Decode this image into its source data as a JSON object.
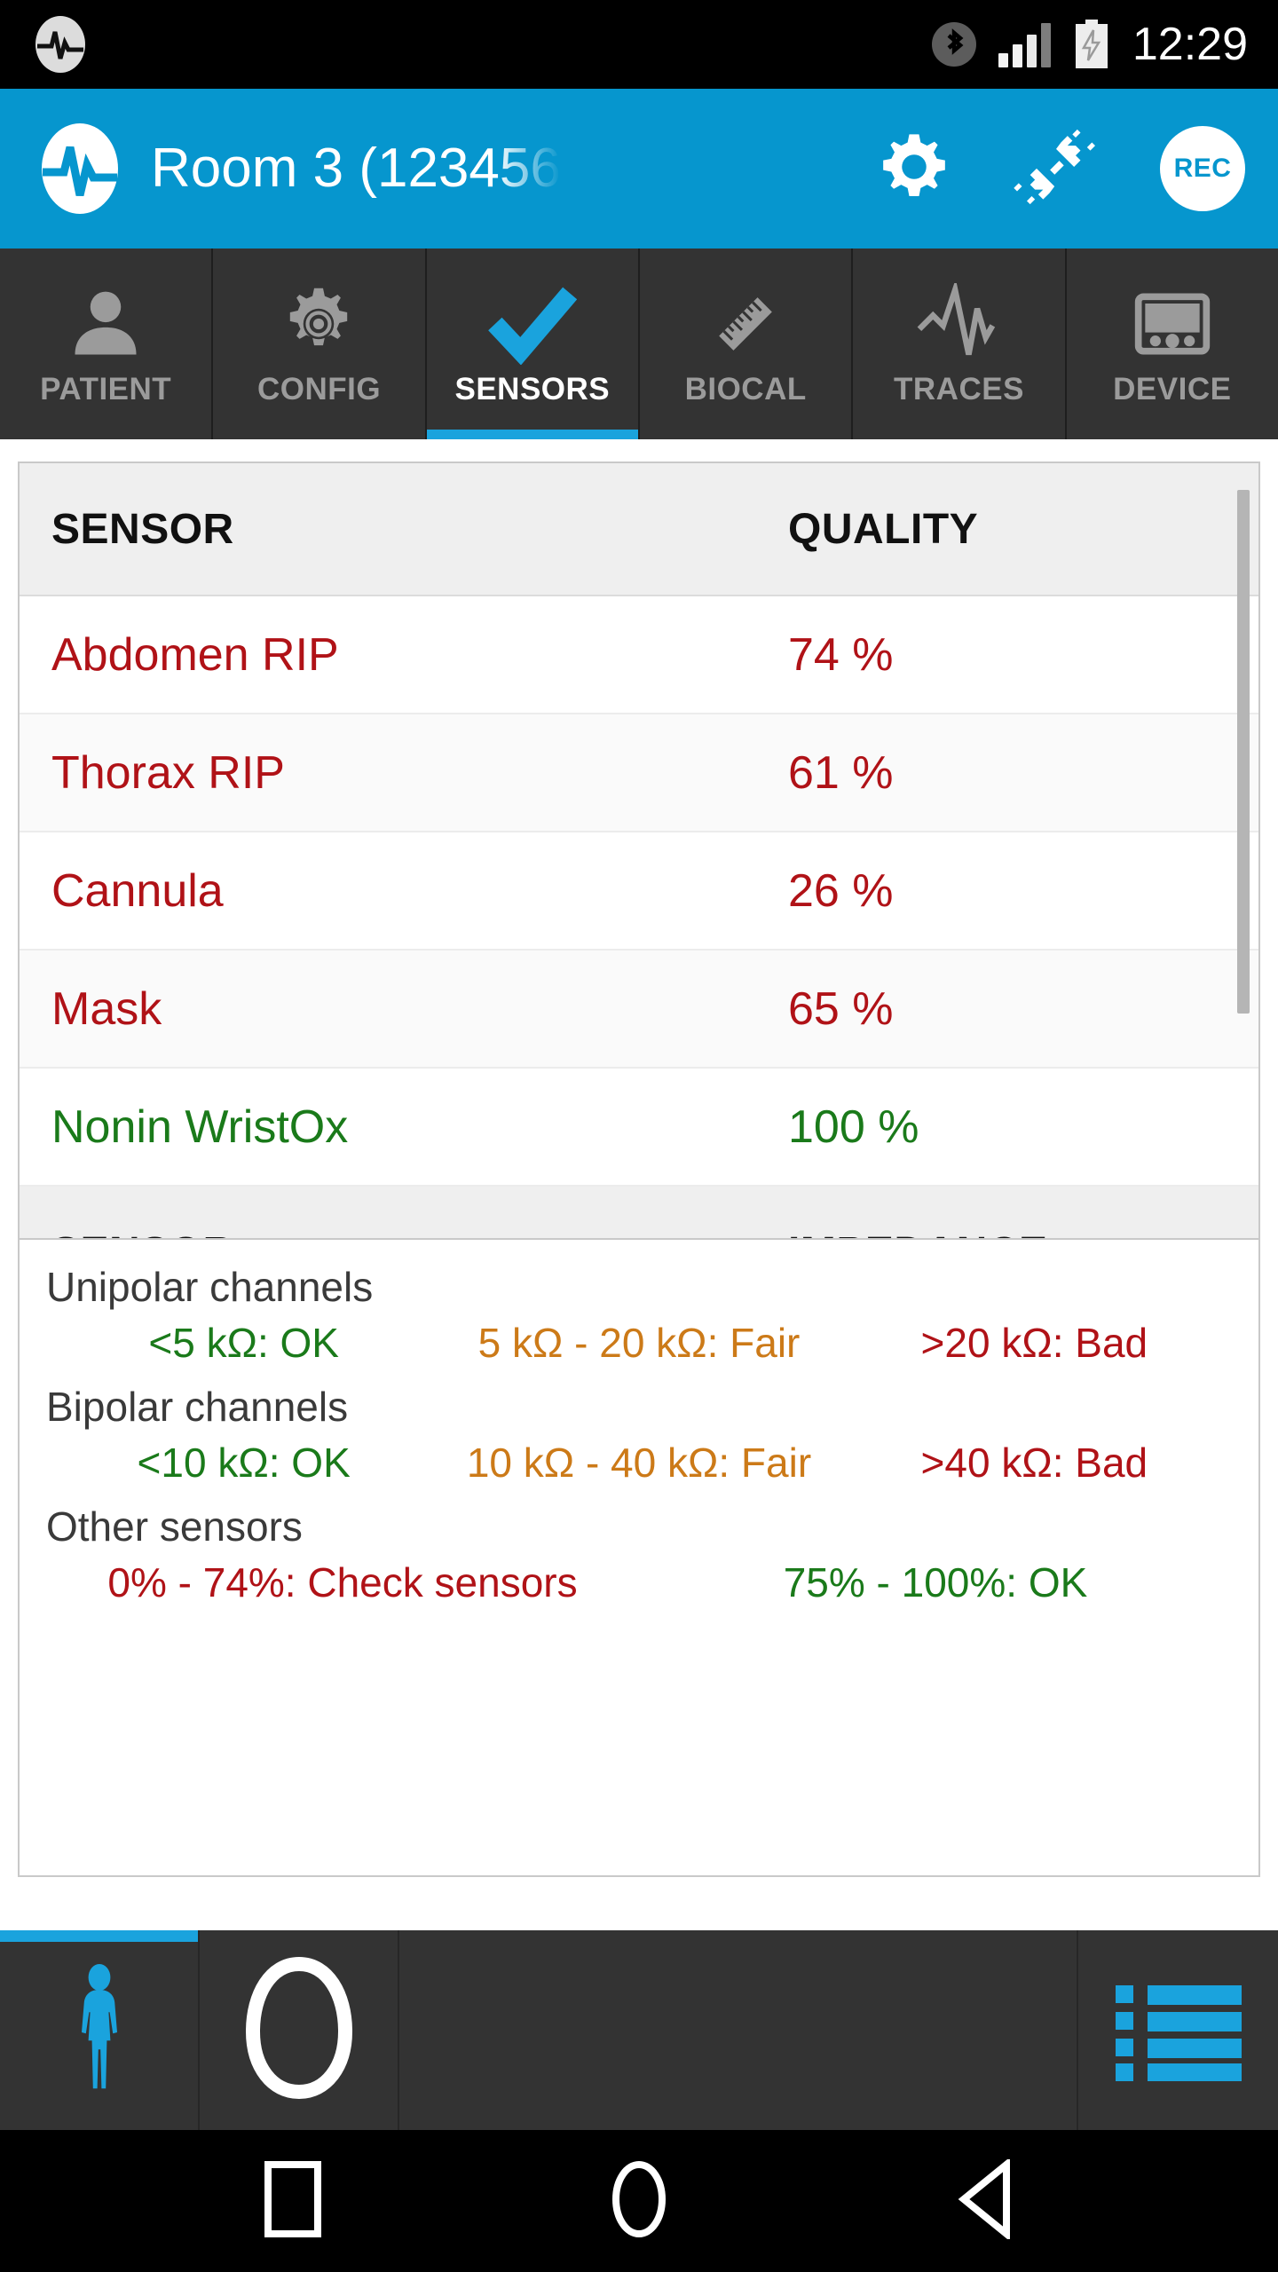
{
  "status_bar": {
    "app_icon": "waveform-logo-icon",
    "bluetooth_icon": "bluetooth-icon",
    "signal_icon": "cellular-signal-icon",
    "battery_icon": "battery-charging-icon",
    "time": "12:29"
  },
  "app_bar": {
    "logo_icon": "waveform-logo-icon",
    "title": "Room 3 (123456",
    "settings_icon": "gear-icon",
    "disconnect_icon": "unplugged-icon",
    "record_label": "REC"
  },
  "tabs": [
    {
      "label": "PATIENT",
      "icon": "person-icon",
      "active": false
    },
    {
      "label": "CONFIG",
      "icon": "gear-icon",
      "active": false
    },
    {
      "label": "SENSORS",
      "icon": "check-icon",
      "active": true
    },
    {
      "label": "BIOCAL",
      "icon": "ruler-icon",
      "active": false
    },
    {
      "label": "TRACES",
      "icon": "waveform-icon",
      "active": false
    },
    {
      "label": "DEVICE",
      "icon": "device-icon",
      "active": false
    }
  ],
  "sensor_table": {
    "headers": {
      "sensor": "SENSOR",
      "quality": "QUALITY"
    },
    "rows": [
      {
        "sensor": "Abdomen RIP",
        "quality": "74 %",
        "status": "bad"
      },
      {
        "sensor": "Thorax RIP",
        "quality": "61 %",
        "status": "bad"
      },
      {
        "sensor": "Cannula",
        "quality": "26 %",
        "status": "bad"
      },
      {
        "sensor": "Mask",
        "quality": "65 %",
        "status": "bad"
      },
      {
        "sensor": "Nonin WristOx",
        "quality": "100 %",
        "status": "good"
      }
    ],
    "next_headers": {
      "sensor": "SENSOR",
      "impedance": "IMPEDANCE"
    }
  },
  "legend": {
    "unipolar": {
      "title": "Unipolar channels",
      "ok": "<5 kΩ: OK",
      "fair": "5 kΩ - 20 kΩ: Fair",
      "bad": ">20 kΩ: Bad"
    },
    "bipolar": {
      "title": "Bipolar channels",
      "ok": "<10 kΩ: OK",
      "fair": "10 kΩ - 40 kΩ: Fair",
      "bad": ">40 kΩ: Bad"
    },
    "other": {
      "title": "Other sensors",
      "bad": "0% - 74%: Check sensors",
      "ok": "75% - 100%: OK"
    }
  },
  "bottom_bar": {
    "items": [
      {
        "icon": "body-person-icon",
        "active": true
      },
      {
        "icon": "head-outline-icon",
        "active": false
      },
      {
        "icon": "list-icon",
        "active": false
      }
    ]
  },
  "nav_bar": {
    "recents_icon": "square-recents-icon",
    "home_icon": "circle-home-icon",
    "back_icon": "triangle-back-icon"
  },
  "colors": {
    "accent_blue": "#0696CE",
    "tab_blue": "#1AA3DD",
    "bad_red": "#B01217",
    "good_green": "#1A7A1A",
    "fair_orange": "#CC7A18",
    "dark_bar": "#333333"
  }
}
